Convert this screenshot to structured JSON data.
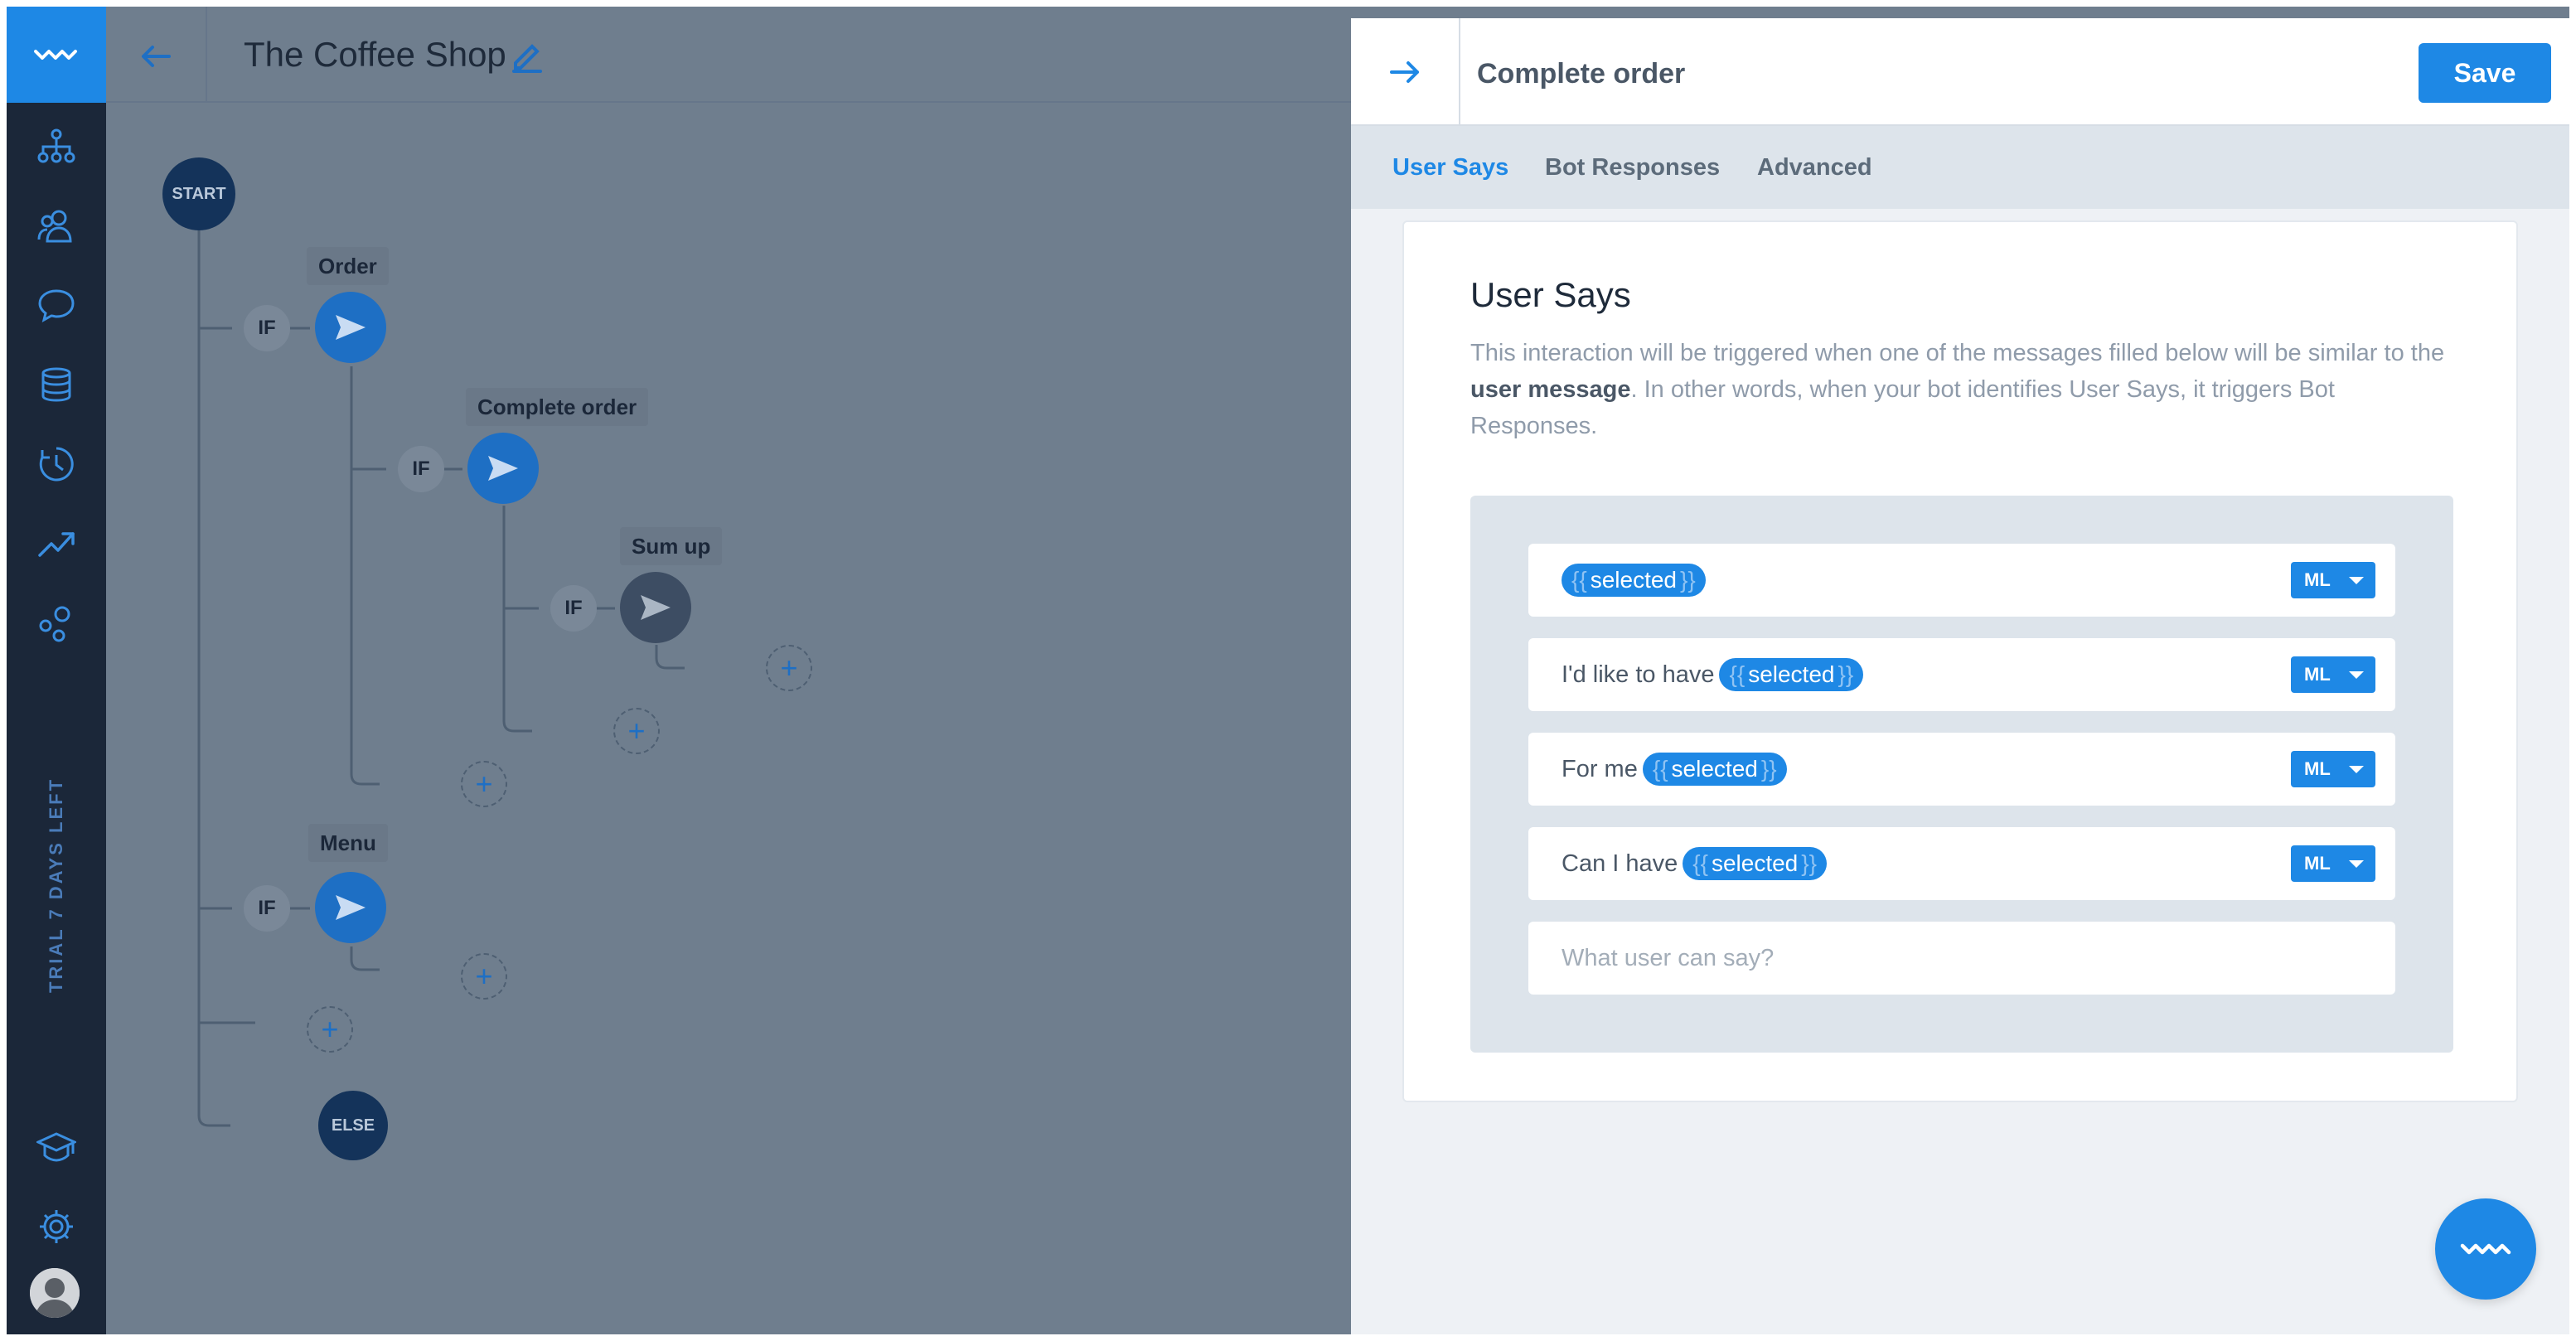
{
  "app": {
    "project_title": "The Coffee Shop",
    "trial_notice": "TRIAL 7 DAYS LEFT"
  },
  "nav": {
    "items": [
      {
        "icon": "flow-tree-icon"
      },
      {
        "icon": "users-icon"
      },
      {
        "icon": "chat-bubble-icon"
      },
      {
        "icon": "database-icon"
      },
      {
        "icon": "history-clock-icon"
      },
      {
        "icon": "analytics-trend-icon"
      },
      {
        "icon": "integrations-icon"
      }
    ],
    "bottom": [
      {
        "icon": "academy-cap-icon"
      },
      {
        "icon": "settings-gear-icon"
      },
      {
        "icon": "user-avatar"
      }
    ]
  },
  "flow": {
    "start_label": "START",
    "else_label": "ELSE",
    "if_label": "IF",
    "nodes": [
      {
        "label": "Order"
      },
      {
        "label": "Complete order"
      },
      {
        "label": "Sum up"
      },
      {
        "label": "Menu"
      }
    ],
    "add_symbol": "+"
  },
  "panel": {
    "title": "Complete order",
    "save_label": "Save",
    "tabs": [
      {
        "label": "User Says",
        "active": true
      },
      {
        "label": "Bot Responses",
        "active": false
      },
      {
        "label": "Advanced",
        "active": false
      }
    ],
    "section_title": "User Says",
    "desc_part1": "This interaction will be triggered when one of the messages filled below will be similar to the ",
    "desc_bold": "user message",
    "desc_part2": ". In other words, when your bot identifies User Says, it triggers Bot Responses.",
    "entity_open": "{{",
    "entity_close": "}}",
    "utterances": [
      {
        "prefix": "",
        "entity": "selected",
        "match": "ML"
      },
      {
        "prefix": "I'd like to have",
        "entity": "selected",
        "match": "ML"
      },
      {
        "prefix": "For me",
        "entity": "selected",
        "match": "ML"
      },
      {
        "prefix": "Can I have",
        "entity": "selected",
        "match": "ML"
      }
    ],
    "new_utterance_placeholder": "What user can say?"
  },
  "colors": {
    "accent": "#1e88e5",
    "rail": "#1b2739",
    "canvas": "#6f7e8e",
    "panel_bg": "#eef1f5"
  }
}
